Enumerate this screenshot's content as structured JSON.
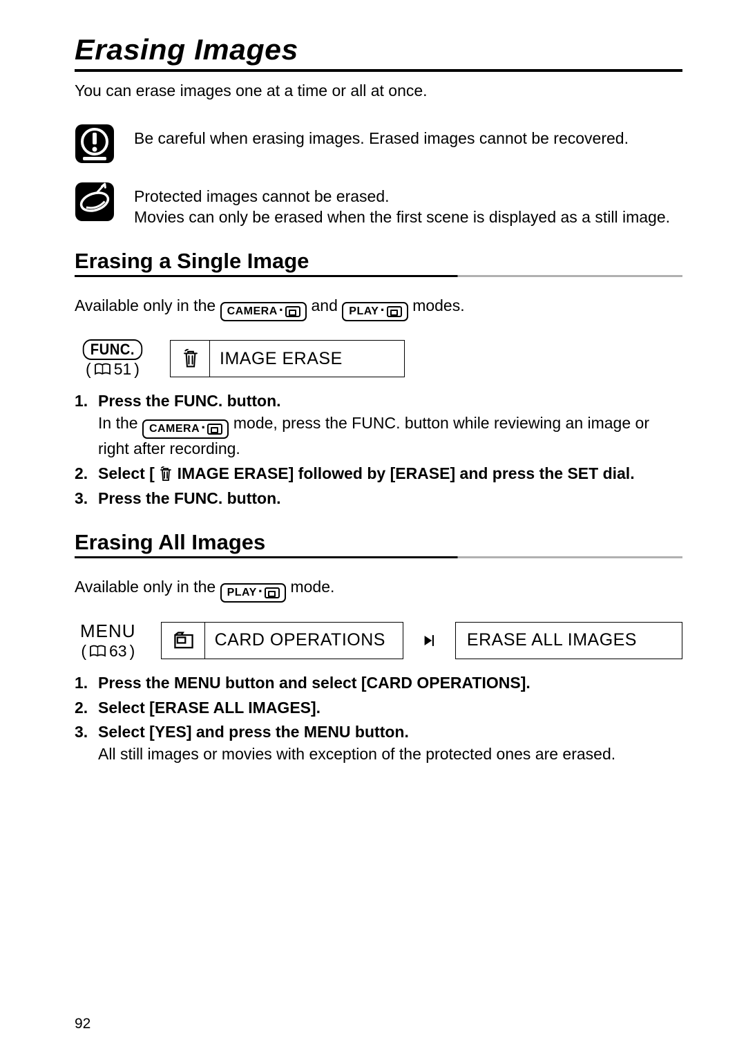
{
  "page": {
    "title": "Erasing Images",
    "intro": "You can erase images one at a time or all at once.",
    "page_number": "92"
  },
  "callouts": {
    "warning": "Be careful when erasing images. Erased images cannot be recovered.",
    "note_line1": "Protected images cannot be erased.",
    "note_line2": "Movies can only be erased when the first scene is displayed as a still image."
  },
  "section1": {
    "heading": "Erasing a Single Image",
    "avail_pre": "Available only in the ",
    "avail_mid": " and ",
    "avail_post": " modes.",
    "func_label": "FUNC.",
    "func_page": "51",
    "menu_item": "IMAGE ERASE",
    "steps": {
      "s1_head": "Press the FUNC. button.",
      "s1_body_pre": "In the ",
      "s1_body_post": " mode, press the FUNC. button while reviewing an image or right after recording.",
      "s2_head_pre": "Select [ ",
      "s2_head_post": " IMAGE ERASE] followed by [ERASE] and press the SET dial.",
      "s3_head": "Press the FUNC. button."
    }
  },
  "section2": {
    "heading": "Erasing All Images",
    "avail_pre": "Available only in the ",
    "avail_post": " mode.",
    "menu_label": "MENU",
    "menu_page": "63",
    "menu_item1": "CARD OPERATIONS",
    "menu_item2": "ERASE ALL IMAGES",
    "steps": {
      "s1_head": "Press the MENU button and select [CARD OPERATIONS].",
      "s2_head": "Select [ERASE ALL IMAGES].",
      "s3_head": "Select [YES] and press the MENU button.",
      "s3_body": "All still images or movies with exception of the protected ones are erased."
    }
  },
  "modes": {
    "camera": "CAMERA",
    "play": "PLAY"
  }
}
